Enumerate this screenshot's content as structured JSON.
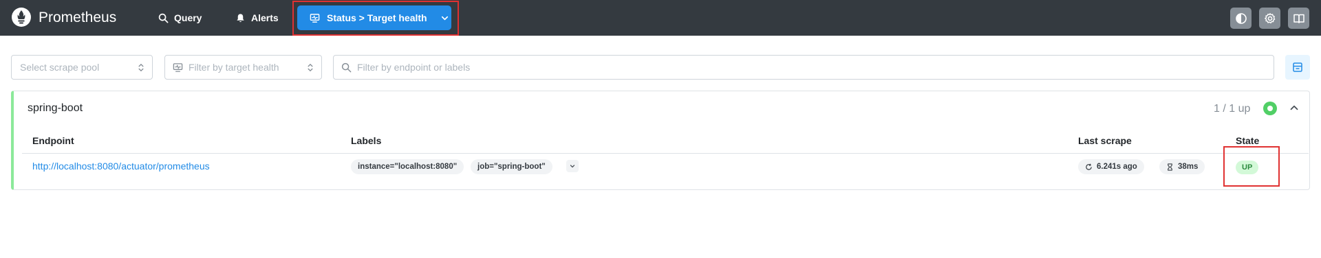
{
  "header": {
    "brand": "Prometheus",
    "nav": {
      "query_label": "Query",
      "alerts_label": "Alerts",
      "status_label": "Status > Target health"
    },
    "buttons": {
      "theme_icon": "contrast-icon",
      "settings_icon": "gear-icon",
      "docs_icon": "book-icon"
    }
  },
  "filters": {
    "scrape_pool_placeholder": "Select scrape pool",
    "health_placeholder": "Filter by target health",
    "search_placeholder": "Filter by endpoint or labels"
  },
  "pool": {
    "name": "spring-boot",
    "up_count": "1 / 1 up",
    "columns": {
      "endpoint": "Endpoint",
      "labels": "Labels",
      "last_scrape": "Last scrape",
      "state": "State"
    },
    "targets": [
      {
        "endpoint": "http://localhost:8080/actuator/prometheus",
        "labels": [
          "instance=\"localhost:8080\"",
          "job=\"spring-boot\""
        ],
        "last_scrape": "6.241s ago",
        "scrape_duration": "38ms",
        "state": "UP"
      }
    ]
  },
  "colors": {
    "header_bg": "#343a40",
    "accent": "#228be6",
    "up_green": "#51cf66",
    "up_badge_bg": "#d3f9d8",
    "up_badge_text": "#2b8a3e",
    "highlight_red": "#e03131"
  }
}
